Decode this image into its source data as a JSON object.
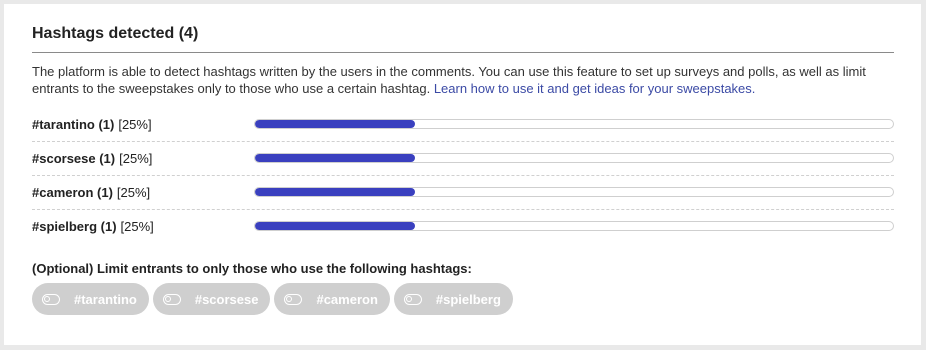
{
  "header": {
    "title": "Hashtags detected (4)"
  },
  "description": {
    "text": "The platform is able to detect hashtags written by the users in the comments. You can use this feature to set up surveys and polls, as well as limit entrants to the sweepstakes only to those who use a certain hashtag. ",
    "link": "Learn how to use it and get ideas for your sweepstakes."
  },
  "hashtags": [
    {
      "tag": "#tarantino (1)",
      "pct": "[25%]",
      "fraction": 0.25
    },
    {
      "tag": "#scorsese (1)",
      "pct": "[25%]",
      "fraction": 0.25
    },
    {
      "tag": "#cameron (1)",
      "pct": "[25%]",
      "fraction": 0.25
    },
    {
      "tag": "#spielberg (1)",
      "pct": "[25%]",
      "fraction": 0.25
    }
  ],
  "filter": {
    "label": "(Optional) Limit entrants to only those who use the following hashtags:",
    "chips": [
      "#tarantino",
      "#scorsese",
      "#cameron",
      "#spielberg"
    ]
  },
  "colors": {
    "bar_fill": "#3a40bf",
    "chip_bg": "#cfcfcf",
    "link": "#3b4aa5"
  }
}
